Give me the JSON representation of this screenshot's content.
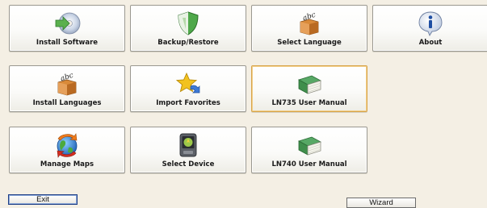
{
  "tiles": [
    {
      "label": "Install Software"
    },
    {
      "label": "Backup/Restore"
    },
    {
      "label": "Select Language"
    },
    {
      "label": "About"
    },
    {
      "label": "Install Languages"
    },
    {
      "label": "Import Favorites"
    },
    {
      "label": "LN735 User Manual",
      "selected": true
    },
    {
      "label": "Manage Maps"
    },
    {
      "label": "Select Device"
    },
    {
      "label": "LN740 User Manual"
    }
  ],
  "buttons": {
    "exit_label": "Exit",
    "wizard_label": "Wizard"
  },
  "icons": {
    "install_software": "cd-arrow-icon",
    "backup_restore": "shield-icon",
    "select_language": "abc-box-icon",
    "about": "info-bubble-icon",
    "install_languages": "abc-box-icon",
    "import_favorites": "star-arrow-icon",
    "ln735_manual": "green-book-icon",
    "manage_maps": "globe-arrows-icon",
    "select_device": "gps-device-icon",
    "ln740_manual": "green-book-icon"
  },
  "colors": {
    "background": "#f4efe4",
    "selected_border": "#d7a44a",
    "book_green": "#3f8e4b"
  }
}
